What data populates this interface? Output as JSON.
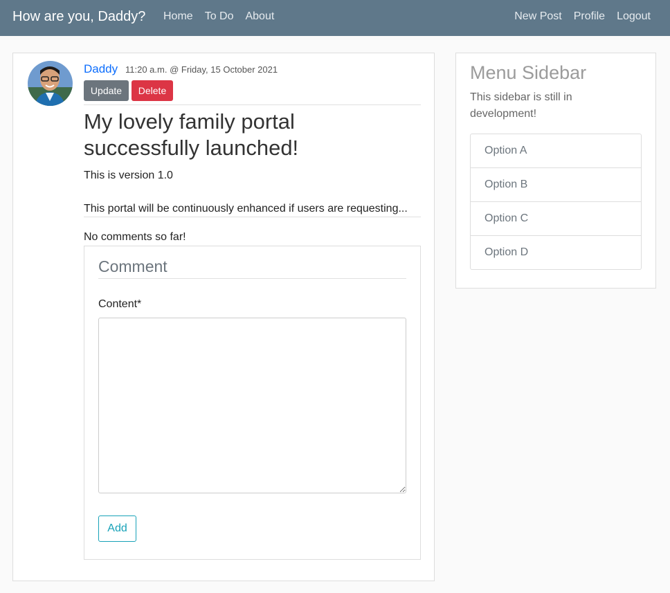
{
  "navbar": {
    "brand": "How are you, Daddy?",
    "left_links": [
      "Home",
      "To Do",
      "About"
    ],
    "right_links": [
      "New Post",
      "Profile",
      "Logout"
    ]
  },
  "post": {
    "author": "Daddy",
    "timestamp": "11:20 a.m. @ Friday, 15 October 2021",
    "update_label": "Update",
    "delete_label": "Delete",
    "title": "My lovely family portal successfully launched!",
    "body_line1": "This is version 1.0",
    "body_line2": "This portal will be continuously enhanced if users are requesting...",
    "no_comments": "No comments so far!"
  },
  "comment_form": {
    "title": "Comment",
    "content_label": "Content*",
    "content_value": "",
    "add_label": "Add"
  },
  "sidebar": {
    "title": "Menu Sidebar",
    "description": "This sidebar is still in development!",
    "options": [
      "Option A",
      "Option B",
      "Option C",
      "Option D"
    ]
  },
  "colors": {
    "navbar_bg": "#5f788a",
    "link_blue": "#0d6efd",
    "update_gray": "#6c757d",
    "delete_red": "#dc3545",
    "add_teal": "#17a2b8"
  }
}
